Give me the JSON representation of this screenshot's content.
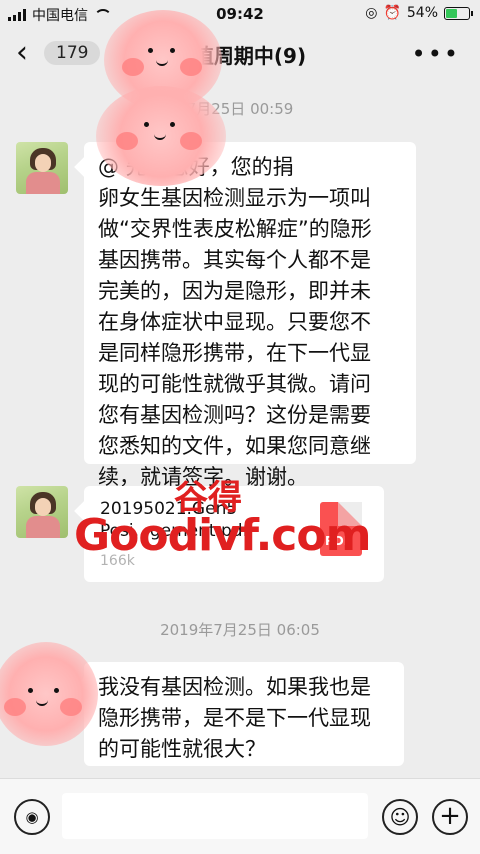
{
  "status_bar": {
    "carrier": "中国电信",
    "time": "09:42",
    "battery_percent": "54%",
    "battery_level": 0.54
  },
  "nav": {
    "back_count": "179",
    "title": "移植周期中(9)",
    "more_icon": "more-dots-icon"
  },
  "messages": [
    {
      "timestamp": "7月25日 00:59",
      "type": "text",
      "text": "@       先生您好，您的捐\n卵女生基因检测显示为一项叫\n做“交界性表皮松解症”的隐形\n基因携带。其实每个人都不是\n完美的，因为是隐形，即并未\n在身体症状中显现。只要您不\n是同样隐形携带，在下一代显\n现的可能性就微乎其微。请问\n您有基因检测吗？这份是需要\n您悉知的文件，如果您同意继\n续，就请签字。谢谢。"
    },
    {
      "type": "file",
      "file_name": "20195021.Gen5\nPosi...gement.pdf",
      "file_size": "166k",
      "file_icon": "pdf-icon",
      "file_label": "PDF"
    },
    {
      "timestamp": "2019年7月25日 06:05",
      "type": "text",
      "text": "我没有基因检测。如果我也是\n隐形携带，是不是下一代显现\n的可能性就很大？"
    }
  ],
  "watermark": {
    "cn": "谷得",
    "en": "Goodivf.com"
  },
  "input_bar": {
    "voice_icon": "voice-icon",
    "emoji_icon": "emoji-icon",
    "plus_icon": "plus-icon"
  },
  "colors": {
    "background": "#ededed",
    "bubble": "#ffffff",
    "watermark": "#e02020",
    "pdf": "#fa5151",
    "battery": "#34c759"
  }
}
